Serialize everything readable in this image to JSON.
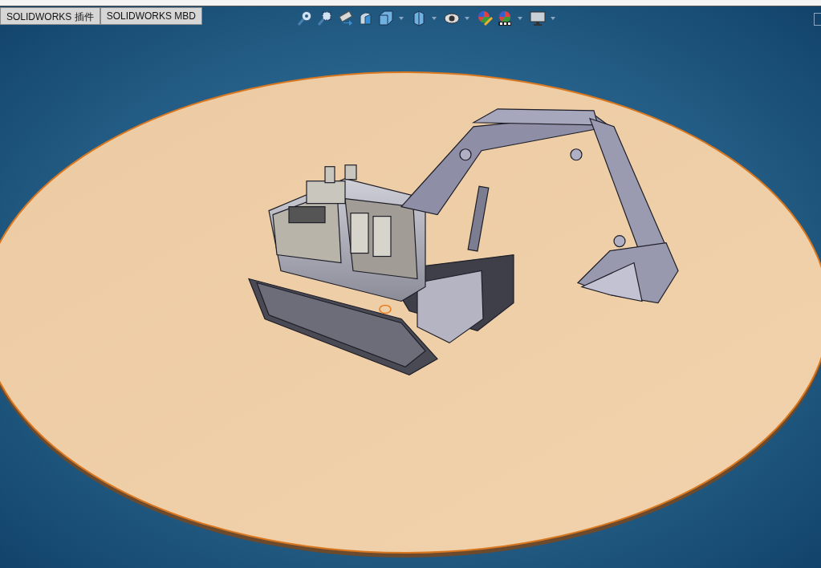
{
  "tabs": [
    {
      "label": "SOLIDWORKS 插件"
    },
    {
      "label": "SOLIDWORKS MBD"
    }
  ]
}
